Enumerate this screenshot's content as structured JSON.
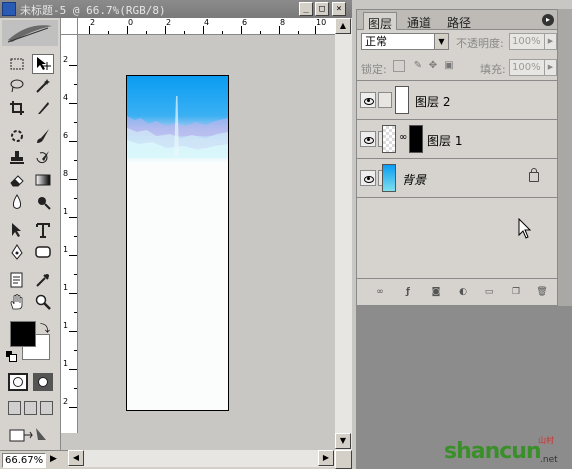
{
  "document": {
    "title": "未标题-5 @ 66.7%(RGB/8)",
    "zoom": "66.67%"
  },
  "window_buttons": {
    "minimize": "_",
    "maximize": "□",
    "close": "×"
  },
  "rulers": {
    "top_labels": [
      "2",
      "0",
      "2",
      "4",
      "6",
      "8",
      "10",
      "12"
    ],
    "left_labels": [
      "2",
      "4",
      "6",
      "8",
      "1",
      "1",
      "1",
      "1",
      "1",
      "2",
      "2"
    ]
  },
  "layers_panel": {
    "tabs": [
      "图层",
      "通道",
      "路径"
    ],
    "active_tab": "图层",
    "blend_mode": "正常",
    "opacity_label": "不透明度:",
    "opacity_value": "100%",
    "lock_label": "锁定:",
    "fill_label": "填充:",
    "fill_value": "100%",
    "layers": [
      {
        "name": "图层 2",
        "visible": true
      },
      {
        "name": "图层 1",
        "visible": true,
        "has_mask": true
      },
      {
        "name": "背景",
        "visible": true,
        "locked": true
      }
    ]
  },
  "watermark": {
    "text": "shancun",
    "sub": "山村",
    "net": ".net"
  },
  "colors": {
    "foreground": "#000000",
    "background": "#ffffff",
    "sky_top": "#0aa0f0",
    "sky_mid": "#b9d9f5"
  }
}
